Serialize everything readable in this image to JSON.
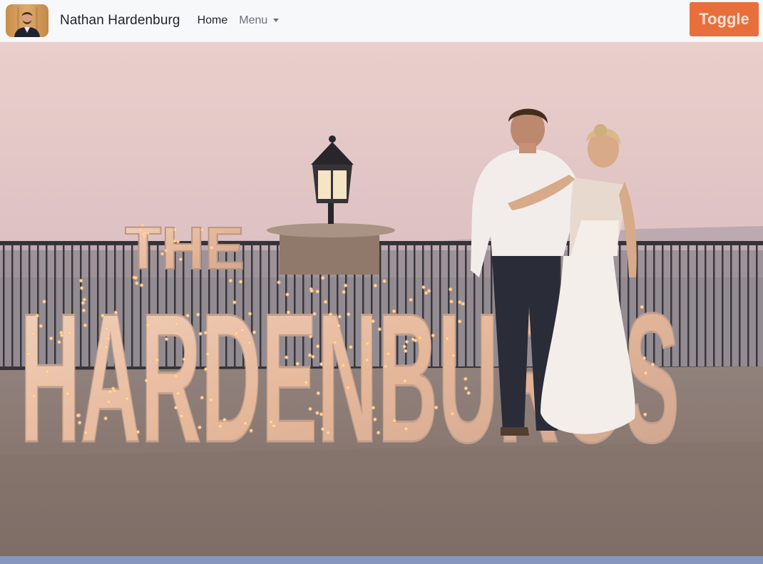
{
  "navbar": {
    "brand_name": "Nathan Hardenburg",
    "avatar_icon": "profile-photo-icon",
    "links": [
      {
        "label": "Home"
      },
      {
        "label": "Menu",
        "icon": "caret-down-icon"
      }
    ],
    "toggle_label": "Toggle"
  },
  "hero": {
    "sign_small": "THE",
    "sign_large": "HARDENBURGS"
  },
  "colors": {
    "navbar_bg": "#f7f8fa",
    "toggle_bg": "#e86f3b",
    "bottom_strip": "#8696bf"
  }
}
